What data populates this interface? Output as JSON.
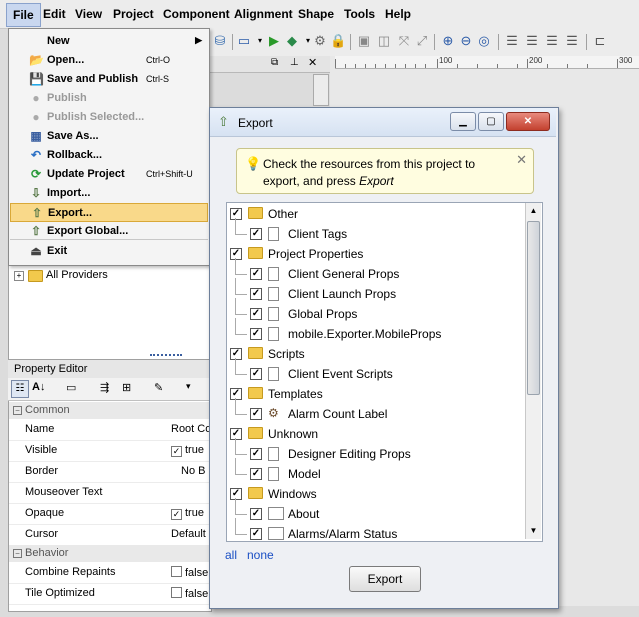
{
  "menubar": [
    {
      "label": "File"
    },
    {
      "label": "Edit"
    },
    {
      "label": "View"
    },
    {
      "label": "Project"
    },
    {
      "label": "Component"
    },
    {
      "label": "Alignment"
    },
    {
      "label": "Shape"
    },
    {
      "label": "Tools"
    },
    {
      "label": "Help"
    }
  ],
  "file_menu": [
    {
      "label": "New",
      "shortcut": "",
      "icon": "new-icon",
      "disabled": false,
      "submenu": true
    },
    {
      "label": "Open...",
      "shortcut": "Ctrl-O",
      "icon": "open-folder-icon",
      "disabled": false
    },
    {
      "label": "Save and Publish",
      "shortcut": "Ctrl-S",
      "icon": "save-publish-icon",
      "disabled": false
    },
    {
      "label": "Publish",
      "shortcut": "",
      "icon": "publish-icon",
      "disabled": true
    },
    {
      "label": "Publish Selected...",
      "shortcut": "",
      "icon": "publish-selected-icon",
      "disabled": true
    },
    {
      "label": "Save As...",
      "shortcut": "",
      "icon": "save-as-icon",
      "disabled": false
    },
    {
      "label": "Rollback...",
      "shortcut": "",
      "icon": "rollback-icon",
      "disabled": false
    },
    {
      "label": "Update Project",
      "shortcut": "Ctrl+Shift-U",
      "icon": "update-project-icon",
      "disabled": false
    },
    {
      "label": "Import...",
      "shortcut": "",
      "icon": "import-icon",
      "disabled": false
    },
    {
      "label": "Export...",
      "shortcut": "",
      "icon": "export-icon",
      "disabled": false,
      "highlighted": true
    },
    {
      "label": "Export Global...",
      "shortcut": "",
      "icon": "export-global-icon",
      "disabled": false
    },
    {
      "label": "Exit",
      "shortcut": "",
      "icon": "exit-icon",
      "disabled": false
    }
  ],
  "left_tree": {
    "all_providers": "All Providers"
  },
  "ruler": {
    "labels": [
      "100",
      "200",
      "300"
    ]
  },
  "property_editor": {
    "title": "Property Editor",
    "categories": [
      {
        "name": "Common",
        "rows": [
          {
            "key": "Name",
            "value": "Root Co",
            "checkbox": false
          },
          {
            "key": "Visible",
            "value": "true",
            "checkbox": true,
            "checked": true
          },
          {
            "key": "Border",
            "value": "No B",
            "checkbox": false
          },
          {
            "key": "Mouseover Text",
            "value": "",
            "checkbox": false
          },
          {
            "key": "Opaque",
            "value": "true",
            "checkbox": true,
            "checked": true
          },
          {
            "key": "Cursor",
            "value": "Default",
            "checkbox": false
          }
        ]
      },
      {
        "name": "Behavior",
        "rows": [
          {
            "key": "Combine Repaints",
            "value": "false",
            "checkbox": true,
            "checked": false
          },
          {
            "key": "Tile Optimized",
            "value": "false",
            "checkbox": true,
            "checked": false
          }
        ]
      }
    ]
  },
  "dialog": {
    "title": "Export",
    "tip_text": "Check the resources from this project to export, and press ",
    "tip_em": "Export",
    "tree": [
      {
        "label": "Other",
        "level": 0,
        "type": "folder",
        "checked": true
      },
      {
        "label": "Client Tags",
        "level": 1,
        "type": "page",
        "checked": true
      },
      {
        "label": "Project Properties",
        "level": 0,
        "type": "folder",
        "checked": true
      },
      {
        "label": "Client General Props",
        "level": 1,
        "type": "page",
        "checked": true
      },
      {
        "label": "Client Launch Props",
        "level": 1,
        "type": "page",
        "checked": true
      },
      {
        "label": "Global Props",
        "level": 1,
        "type": "page",
        "checked": true
      },
      {
        "label": "mobile.Exporter.MobileProps",
        "level": 1,
        "type": "page",
        "checked": true
      },
      {
        "label": "Scripts",
        "level": 0,
        "type": "folder",
        "checked": true
      },
      {
        "label": "Client Event Scripts",
        "level": 1,
        "type": "page",
        "checked": true
      },
      {
        "label": "Templates",
        "level": 0,
        "type": "folder",
        "checked": true
      },
      {
        "label": "Alarm Count Label",
        "level": 1,
        "type": "template",
        "checked": true
      },
      {
        "label": "Unknown",
        "level": 0,
        "type": "folder",
        "checked": true
      },
      {
        "label": "Designer Editing Props",
        "level": 1,
        "type": "page",
        "checked": true
      },
      {
        "label": "Model",
        "level": 1,
        "type": "page",
        "checked": true
      },
      {
        "label": "Windows",
        "level": 0,
        "type": "folder",
        "checked": true
      },
      {
        "label": "About",
        "level": 1,
        "type": "window",
        "checked": true
      },
      {
        "label": "Alarms/Alarm Status",
        "level": 1,
        "type": "window",
        "checked": true
      }
    ],
    "link_all": "all",
    "link_none": "none",
    "export_button": "Export"
  }
}
